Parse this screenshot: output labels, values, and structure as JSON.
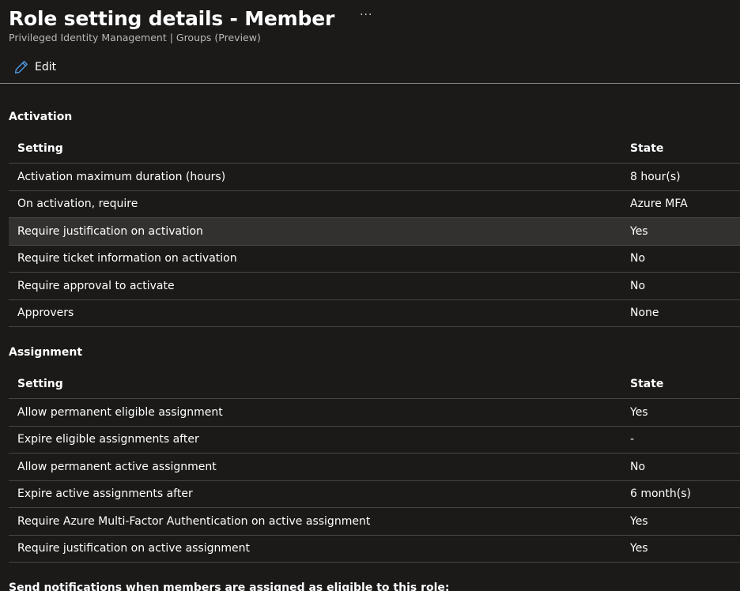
{
  "header": {
    "title": "Role setting details - Member",
    "more_label": "···",
    "subtitle": "Privileged Identity Management | Groups (Preview)"
  },
  "toolbar": {
    "edit_label": "Edit",
    "edit_icon": "pencil-icon",
    "accent_color": "#4f9ae0"
  },
  "activation": {
    "title": "Activation",
    "columns": {
      "setting": "Setting",
      "state": "State"
    },
    "rows": [
      {
        "setting": "Activation maximum duration (hours)",
        "state": "8 hour(s)"
      },
      {
        "setting": "On activation, require",
        "state": "Azure MFA"
      },
      {
        "setting": "Require justification on activation",
        "state": "Yes"
      },
      {
        "setting": "Require ticket information on activation",
        "state": "No"
      },
      {
        "setting": "Require approval to activate",
        "state": "No"
      },
      {
        "setting": "Approvers",
        "state": "None"
      }
    ]
  },
  "assignment": {
    "title": "Assignment",
    "columns": {
      "setting": "Setting",
      "state": "State"
    },
    "rows": [
      {
        "setting": "Allow permanent eligible assignment",
        "state": "Yes"
      },
      {
        "setting": "Expire eligible assignments after",
        "state": "-"
      },
      {
        "setting": "Allow permanent active assignment",
        "state": "No"
      },
      {
        "setting": "Expire active assignments after",
        "state": "6 month(s)"
      },
      {
        "setting": "Require Azure Multi-Factor Authentication on active assignment",
        "state": "Yes"
      },
      {
        "setting": "Require justification on active assignment",
        "state": "Yes"
      }
    ]
  },
  "notifications": {
    "title": "Send notifications when members are assigned as eligible to this role:"
  }
}
